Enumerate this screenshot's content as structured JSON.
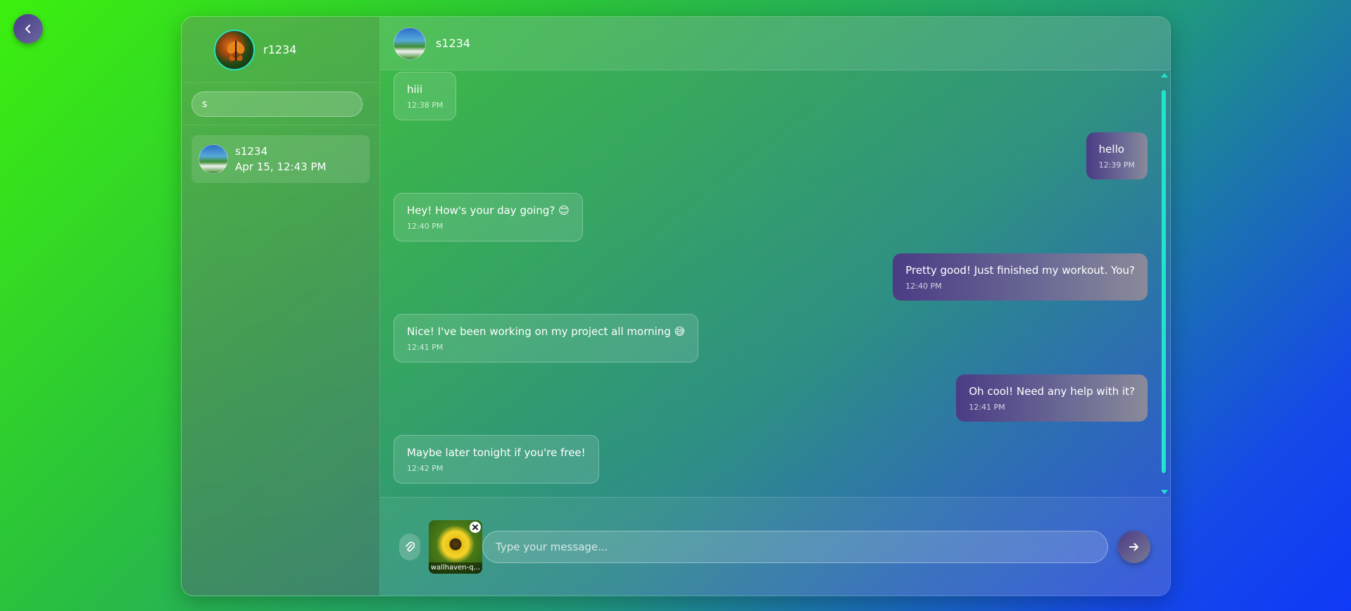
{
  "current_user": {
    "name": "r1234"
  },
  "search": {
    "value": "s"
  },
  "contacts": [
    {
      "name": "s1234",
      "last_seen": "Apr 15, 12:43 PM"
    }
  ],
  "chat": {
    "contact_name": "s1234",
    "messages": [
      {
        "direction": "in",
        "text": "hiii",
        "time": "12:38 PM"
      },
      {
        "direction": "out",
        "text": "hello",
        "time": "12:39 PM"
      },
      {
        "direction": "in",
        "text": "Hey! How's your day going? 😊",
        "time": "12:40 PM"
      },
      {
        "direction": "out",
        "text": "Pretty good! Just finished my workout. You?",
        "time": "12:40 PM"
      },
      {
        "direction": "in",
        "text": "Nice! I've been working on my project all morning 😅",
        "time": "12:41 PM"
      },
      {
        "direction": "out",
        "text": "Oh cool! Need any help with it?",
        "time": "12:41 PM"
      },
      {
        "direction": "in",
        "text": "Maybe later tonight if you're free!",
        "time": "12:42 PM"
      }
    ]
  },
  "composer": {
    "placeholder": "Type your message...",
    "attachment_name": "wallhaven-q..."
  },
  "icons": {
    "back": "chevron-left-icon",
    "attach": "paperclip-icon",
    "remove": "close-icon",
    "send": "arrow-right-icon"
  },
  "colors": {
    "accent": "#22e3cc",
    "outgoing_bubble": "#4b3b84"
  }
}
